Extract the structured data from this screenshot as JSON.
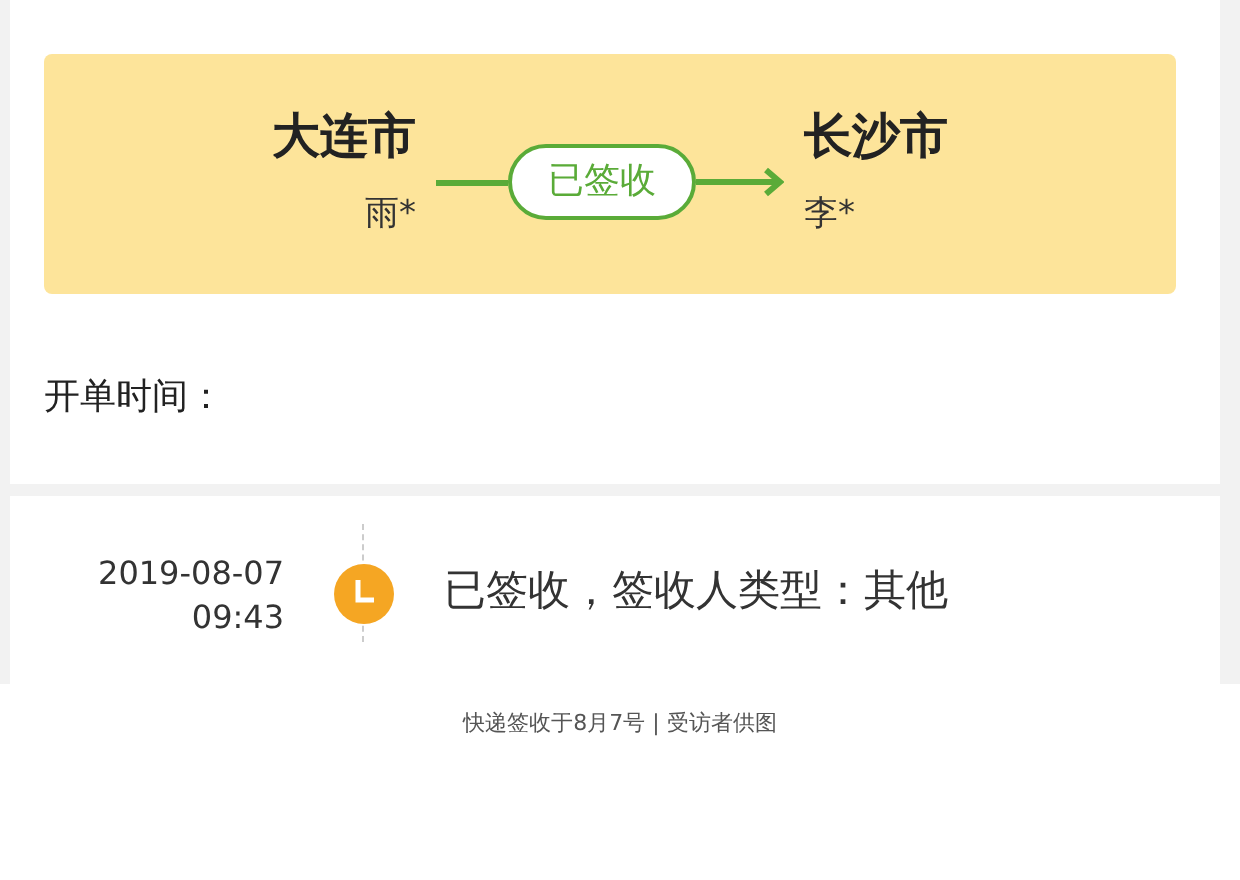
{
  "route": {
    "from_city": "大连市",
    "from_person": "雨*",
    "status": "已签收",
    "to_city": "长沙市",
    "to_person": "李*"
  },
  "order_time_label": "开单时间：",
  "timeline": [
    {
      "date": "2019-08-07",
      "time": "09:43",
      "text": "已签收，签收人类型：其他"
    }
  ],
  "caption": "快递签收于8月7号 | 受访者供图"
}
